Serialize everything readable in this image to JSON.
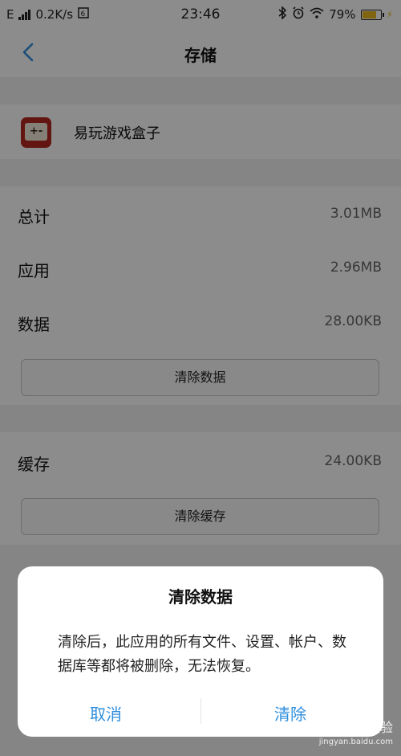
{
  "status_bar": {
    "network_type": "E",
    "speed": "0.2K/s",
    "time": "23:46",
    "battery_percent": "79%",
    "battery_level": 0.79,
    "icons": [
      "signal-icon",
      "data-saver-icon",
      "bluetooth-icon",
      "alarm-icon",
      "wifi-icon",
      "battery-icon",
      "charging-icon"
    ]
  },
  "nav": {
    "title": "存储"
  },
  "app": {
    "name": "易玩游戏盒子",
    "icon_colors": {
      "background": "#b5281f",
      "inner": "#f3ead9"
    }
  },
  "storage": {
    "rows": [
      {
        "label": "总计",
        "value": "3.01MB"
      },
      {
        "label": "应用",
        "value": "2.96MB"
      },
      {
        "label": "数据",
        "value": "28.00KB"
      }
    ],
    "clear_data_button": "清除数据"
  },
  "cache": {
    "label": "缓存",
    "value": "24.00KB",
    "clear_cache_button": "清除缓存"
  },
  "dialog": {
    "title": "清除数据",
    "message": "清除后，此应用的所有文件、设置、帐户、数据库等都将被删除，无法恢复。",
    "cancel_label": "取消",
    "confirm_label": "清除"
  },
  "watermark": {
    "text": "Baidu经验",
    "url": "jingyan.baidu.com"
  },
  "colors": {
    "accent": "#2f8fde",
    "overlay": "rgba(0,0,0,0.45)",
    "battery": "#e9b71d"
  }
}
